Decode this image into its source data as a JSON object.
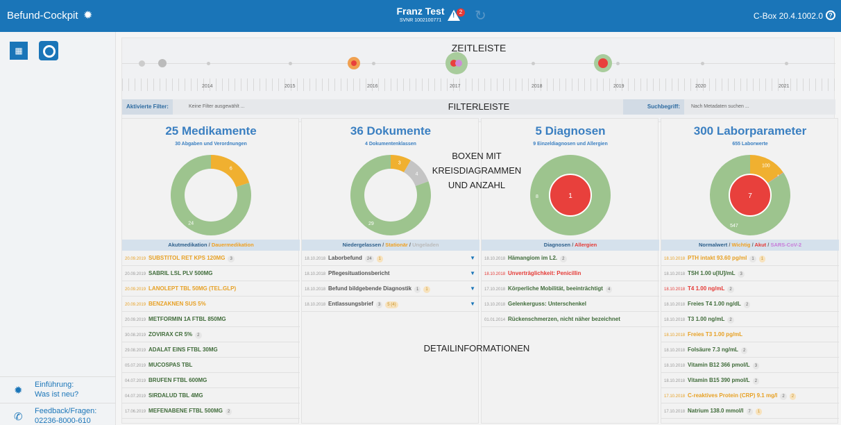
{
  "topbar": {
    "app_title": "Befund-Cockpit",
    "patient_name": "Franz Test",
    "svnr": "SVNR 1002100771",
    "alert_count": "2",
    "version": "C-Box 20.4.1002.0",
    "help_icon": "question-circle-icon",
    "bulb_icon": "lightbulb-icon",
    "alert_icon": "warning-triangle-icon",
    "redo_icon": "redo-icon",
    "color": "#1a75b8"
  },
  "sidebar": {
    "items": [
      {
        "line1": "Einführung:",
        "line2": "Was ist neu?",
        "icon": "lightbulb-icon"
      },
      {
        "line1": "Feedback/Fragen:",
        "line2": "02236-8000-610",
        "icon": "phone-icon"
      }
    ]
  },
  "timeline": {
    "title": "ZEITLEISTE",
    "years": [
      "2014",
      "2015",
      "2016",
      "2017",
      "2018",
      "2019",
      "2020",
      "2021"
    ]
  },
  "filterbar": {
    "title": "FILTERLEISTE",
    "active_label": "Aktivierte Filter:",
    "active_value": "Keine Filter ausgewählt ...",
    "search_label": "Suchbegriff:",
    "search_placeholder": "Nach Metadaten suchen ..."
  },
  "annotations": {
    "boxes_line1": "BOXEN MIT",
    "boxes_line2": "KREISDIAGRAMMEN",
    "boxes_line3": "UND ANZAHL",
    "details": "DETAILINFORMATIONEN"
  },
  "colors": {
    "green": "#9dc48e",
    "orange": "#f0b030",
    "grey": "#c4c4c4",
    "red": "#e8403c",
    "purple": "#c77bd9"
  },
  "cards": {
    "medikamente": {
      "title": "25 Medikamente",
      "subtitle": "30 Abgaben und Verordnungen",
      "slices": [
        {
          "value": "24",
          "color": "green"
        },
        {
          "value": "6",
          "color": "orange"
        }
      ],
      "legend_a": "Akutmedikation",
      "legend_sep": " / ",
      "legend_b": "Dauermedikation",
      "rows": [
        {
          "date": "20.09.2019",
          "name": "SUBSTITOL RET KPS 120MG",
          "badge": "3",
          "orange": true
        },
        {
          "date": "20.09.2019",
          "name": "SABRIL LSL PLV 500MG",
          "badge": "",
          "orange": false
        },
        {
          "date": "20.09.2019",
          "name": "LANOLEPT TBL 50MG (TEL.GLP)",
          "badge": "",
          "orange": true
        },
        {
          "date": "20.09.2019",
          "name": "BENZAKNEN SUS 5%",
          "badge": "",
          "orange": true
        },
        {
          "date": "20.09.2019",
          "name": "METFORMIN 1A FTBL 850MG",
          "badge": "",
          "orange": false
        },
        {
          "date": "30.08.2019",
          "name": "ZOVIRAX CR 5%",
          "badge": "2",
          "orange": false
        },
        {
          "date": "29.08.2019",
          "name": "ADALAT EINS FTBL 30MG",
          "badge": "",
          "orange": false
        },
        {
          "date": "05.07.2019",
          "name": "MUCOSPAS TBL",
          "badge": "",
          "orange": false
        },
        {
          "date": "04.07.2019",
          "name": "BRUFEN FTBL 600MG",
          "badge": "",
          "orange": false
        },
        {
          "date": "04.07.2019",
          "name": "SIRDALUD TBL 4MG",
          "badge": "",
          "orange": false
        },
        {
          "date": "17.06.2019",
          "name": "MEFENABENE FTBL 500MG",
          "badge": "2",
          "orange": false
        }
      ]
    },
    "dokumente": {
      "title": "36 Dokumente",
      "subtitle": "4 Dokumentenklassen",
      "slices": [
        {
          "value": "29",
          "color": "green"
        },
        {
          "value": "3",
          "color": "orange"
        },
        {
          "value": "4",
          "color": "grey"
        }
      ],
      "legend_a": "Niedergelassen",
      "legend_sep": " / ",
      "legend_b": "Stationär",
      "legend_c": "Ungeladen",
      "rows": [
        {
          "date": "18.10.2018",
          "name": "Laborbefund",
          "b1": "24",
          "b2": "1"
        },
        {
          "date": "18.10.2018",
          "name": "Pflegesituationsbericht",
          "b1": "",
          "b2": ""
        },
        {
          "date": "18.10.2018",
          "name": "Befund bildgebende Diagnostik",
          "b1": "1",
          "b2": "1"
        },
        {
          "date": "18.10.2018",
          "name": "Entlassungsbrief",
          "b1": "3",
          "b2": "5 (4)"
        }
      ],
      "filter_icon": "filter-icon"
    },
    "diagnosen": {
      "title": "5 Diagnosen",
      "subtitle": "9 Einzeldiagnosen und Allergien",
      "slices": [
        {
          "value": "8",
          "color": "green"
        },
        {
          "value": "1",
          "color": "red"
        }
      ],
      "legend_a": "Diagnosen",
      "legend_sep": " / ",
      "legend_b": "Allergien",
      "rows": [
        {
          "date": "18.10.2018",
          "name": "Hämangiom im L2.",
          "badge": "2",
          "red": false
        },
        {
          "date": "18.10.2018",
          "name": "Unverträglichkeit: Penicillin",
          "badge": "",
          "red": true
        },
        {
          "date": "17.10.2018",
          "name": "Körperliche Mobilität, beeinträchtigt",
          "badge": "4",
          "red": false
        },
        {
          "date": "13.10.2018",
          "name": "Gelenkerguss: Unterschenkel",
          "badge": "",
          "red": false
        },
        {
          "date": "01.01.2014",
          "name": "Rückenschmerzen, nicht näher bezeichnet",
          "badge": "",
          "red": false
        }
      ]
    },
    "labor": {
      "title": "300 Laborparameter",
      "subtitle": "655 Laborwerte",
      "slices": [
        {
          "value": "547",
          "color": "green"
        },
        {
          "value": "100",
          "color": "orange"
        },
        {
          "value": "1",
          "color": "purple"
        },
        {
          "value": "7",
          "color": "red"
        }
      ],
      "legend_a": "Normalwert",
      "legend_sep": " / ",
      "legend_b": "Wichtig",
      "legend_c": "Akut",
      "legend_d": "SARS-CoV-2",
      "rows": [
        {
          "date": "18.10.2018",
          "name": "PTH intakt 93.60 pg/ml",
          "b1": "1",
          "b2": "1",
          "kind": "orange"
        },
        {
          "date": "18.10.2018",
          "name": "TSH 1.00 u[IU]/mL",
          "b1": "3",
          "b2": "",
          "kind": "normal"
        },
        {
          "date": "18.10.2018",
          "name": "T4 1.00 ng/mL",
          "b1": "2",
          "b2": "",
          "kind": "red"
        },
        {
          "date": "18.10.2018",
          "name": "Freies T4 1.00 ng/dL",
          "b1": "2",
          "b2": "",
          "kind": "normal"
        },
        {
          "date": "18.10.2018",
          "name": "T3 1.00 ng/mL",
          "b1": "2",
          "b2": "",
          "kind": "normal"
        },
        {
          "date": "18.10.2018",
          "name": "Freies T3 1.00 pg/mL",
          "b1": "",
          "b2": "",
          "kind": "orange"
        },
        {
          "date": "18.10.2018",
          "name": "Folsäure 7.3 ng/mL",
          "b1": "2",
          "b2": "",
          "kind": "normal"
        },
        {
          "date": "18.10.2018",
          "name": "Vitamin B12 366 pmol/L",
          "b1": "3",
          "b2": "",
          "kind": "normal"
        },
        {
          "date": "18.10.2018",
          "name": "Vitamin B15 390 pmol/L",
          "b1": "2",
          "b2": "",
          "kind": "normal"
        },
        {
          "date": "17.10.2018",
          "name": "C-reaktives Protein (CRP) 9.1 mg/l",
          "b1": "2",
          "b2": "2",
          "kind": "orange"
        },
        {
          "date": "17.10.2018",
          "name": "Natrium 138.0 mmol/l",
          "b1": "7",
          "b2": "1",
          "kind": "normal"
        }
      ]
    }
  }
}
